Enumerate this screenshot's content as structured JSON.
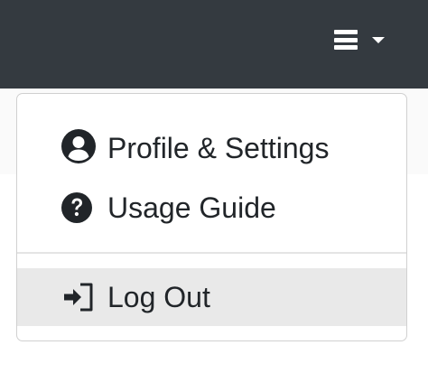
{
  "navbar": {
    "menu_icon": "hamburger-icon",
    "caret_icon": "caret-down-icon"
  },
  "dropdown": {
    "items": [
      {
        "label": "Profile & Settings",
        "icon": "user-circle-icon"
      },
      {
        "label": "Usage Guide",
        "icon": "question-circle-icon"
      },
      {
        "label": "Log Out",
        "icon": "sign-in-icon"
      }
    ]
  },
  "colors": {
    "navbar_bg": "#343a40",
    "text": "#212529",
    "hover_bg": "#e9e9e9"
  }
}
